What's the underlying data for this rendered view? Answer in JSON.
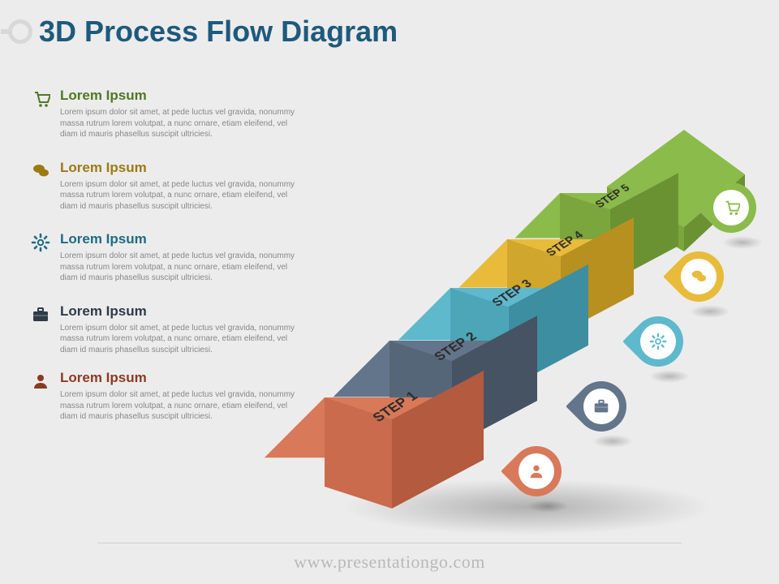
{
  "title": "3D Process Flow Diagram",
  "footer": "www.presentationgo.com",
  "steps": [
    {
      "label": "STEP 1",
      "color": "#d8795a",
      "dark": "#b35a3f",
      "mid": "#c96b4c",
      "title_color": "#8a3b22",
      "icon": "user"
    },
    {
      "label": "STEP 2",
      "color": "#63758a",
      "dark": "#455363",
      "mid": "#566679",
      "title_color": "#2f3b47",
      "icon": "briefcase"
    },
    {
      "label": "STEP 3",
      "color": "#5fb9cd",
      "dark": "#3d8ea1",
      "mid": "#4da5b8",
      "title_color": "#1d6c82",
      "icon": "gear"
    },
    {
      "label": "STEP 4",
      "color": "#e8bb3a",
      "dark": "#b8901f",
      "mid": "#d0a62c",
      "title_color": "#9c7a13",
      "icon": "chat"
    },
    {
      "label": "STEP 5",
      "color": "#8bbb4a",
      "dark": "#6a9233",
      "mid": "#7aa63d",
      "title_color": "#4f7823",
      "icon": "cart"
    }
  ],
  "list": [
    {
      "icon": "cart",
      "title": "Lorem Ipsum",
      "color_key": 4,
      "desc": "Lorem ipsum dolor sit amet, at pede luctus vel gravida, nonummy massa rutrum lorem volutpat, a nunc ornare, etiam eleifend, vel diam id mauris phasellus suscipit ultriciesi."
    },
    {
      "icon": "chat",
      "title": "Lorem Ipsum",
      "color_key": 3,
      "desc": "Lorem ipsum dolor sit amet, at pede luctus vel gravida, nonummy massa rutrum lorem volutpat, a nunc ornare, etiam eleifend, vel diam id mauris phasellus suscipit ultriciesi."
    },
    {
      "icon": "gear",
      "title": "Lorem Ipsum",
      "color_key": 2,
      "desc": "Lorem ipsum dolor sit amet, at pede luctus vel gravida, nonummy massa rutrum lorem volutpat, a nunc ornare, etiam eleifend, vel diam id mauris phasellus suscipit ultriciesi."
    },
    {
      "icon": "briefcase",
      "title": "Lorem Ipsum",
      "color_key": 1,
      "desc": "Lorem ipsum dolor sit amet, at pede luctus vel gravida, nonummy massa rutrum lorem volutpat, a nunc ornare, etiam eleifend, vel diam id mauris phasellus suscipit ultriciesi."
    },
    {
      "icon": "user",
      "title": "Lorem Ipsum",
      "color_key": 0,
      "desc": "Lorem ipsum dolor sit amet, at pede luctus vel gravida, nonummy massa rutrum lorem volutpat, a nunc ornare, etiam eleifend, vel diam id mauris phasellus suscipit ultriciesi."
    }
  ]
}
